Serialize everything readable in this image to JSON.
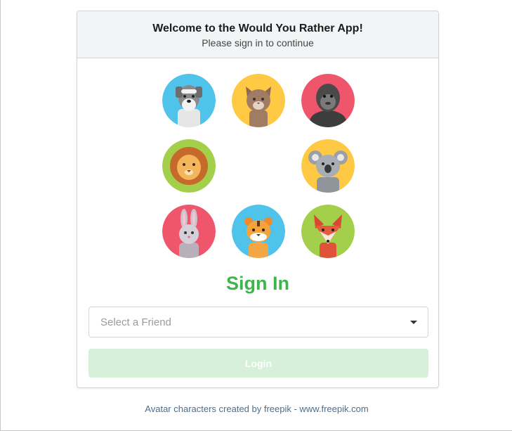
{
  "header": {
    "title": "Welcome to the Would You Rather App!",
    "subtitle": "Please sign in to continue"
  },
  "avatars": [
    {
      "name": "dog-avatar",
      "bg": "#4fc3ea"
    },
    {
      "name": "cat-avatar",
      "bg": "#ffc943"
    },
    {
      "name": "gorilla-avatar",
      "bg": "#f0566b"
    },
    {
      "name": "lion-avatar",
      "bg": "#a3cf4a"
    },
    {
      "name": "koala-avatar",
      "bg": "#ffc943"
    },
    {
      "name": "rabbit-avatar",
      "bg": "#f0566b"
    },
    {
      "name": "tiger-avatar",
      "bg": "#4fc3ea"
    },
    {
      "name": "fox-avatar",
      "bg": "#a3cf4a"
    }
  ],
  "sign_in": {
    "title": "Sign In",
    "select_placeholder": "Select a Friend",
    "login_label": "Login"
  },
  "footer": {
    "text": "Avatar characters created by freepik - www.freepik.com"
  },
  "colors": {
    "accent_green": "#3cb54a",
    "login_disabled_bg": "#d6f0d9",
    "footer_link": "#4d6e8e"
  }
}
